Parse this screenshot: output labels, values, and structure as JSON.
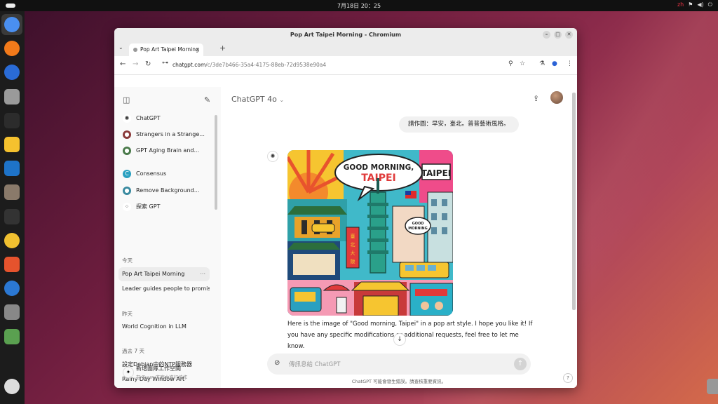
{
  "topbar": {
    "clock": "7月18日 20：25",
    "tray": [
      "zh",
      "⚑",
      "◀)",
      "⏻"
    ]
  },
  "dock": {
    "apps": [
      {
        "name": "chromium",
        "color": "#4a8ff0"
      },
      {
        "name": "firefox",
        "color": "#f27a1a"
      },
      {
        "name": "thunderbird",
        "color": "#2a6bd6"
      },
      {
        "name": "files",
        "color": "#9a9a9a"
      },
      {
        "name": "terminal",
        "color": "#2c2c2c"
      },
      {
        "name": "text-editor",
        "color": "#f5c12e"
      },
      {
        "name": "writer",
        "color": "#1e73c8"
      },
      {
        "name": "gimp",
        "color": "#8a7a6a"
      },
      {
        "name": "inkscape",
        "color": "#333333"
      },
      {
        "name": "rhythmbox",
        "color": "#f0c030"
      },
      {
        "name": "app-center",
        "color": "#e5532d"
      },
      {
        "name": "help",
        "color": "#2b78d3"
      },
      {
        "name": "disk",
        "color": "#888888"
      },
      {
        "name": "trash",
        "color": "#5aa050"
      },
      {
        "name": "ubuntu",
        "color": "#dddddd"
      }
    ]
  },
  "window": {
    "title": "Pop Art Taipei Morning - Chromium",
    "tab_title": "Pop Art Taipei Morning",
    "url_host": "chatgpt.com",
    "url_path": "/c/3de7b466-35a4-4175-88eb-72d9538e90a4"
  },
  "sidebar": {
    "pinned": [
      {
        "label": "ChatGPT",
        "icon": "openai-icon",
        "color": "#ffffff",
        "glyph": "✺"
      },
      {
        "label": "Strangers in a Strange...",
        "icon": "gpt-avatar-icon",
        "color": "#8a3a3a",
        "glyph": "●"
      },
      {
        "label": "GPT Aging Brain and...",
        "icon": "gpt-avatar-icon",
        "color": "#4a7a4a",
        "glyph": "●"
      },
      {
        "label": "Consensus",
        "icon": "consensus-icon",
        "color": "#2aa0c0",
        "glyph": "C"
      },
      {
        "label": "Remove Background...",
        "icon": "gpt-avatar-icon",
        "color": "#3a8aa0",
        "glyph": "●"
      },
      {
        "label": "探索 GPT",
        "icon": "grid-icon",
        "color": "#ffffff",
        "glyph": "⁘"
      }
    ],
    "sections": [
      {
        "title": "今天",
        "items": [
          "Pop Art Taipei Morning",
          "Leader guides people to promise"
        ]
      },
      {
        "title": "昨天",
        "items": [
          "World Cognition in LLM"
        ]
      },
      {
        "title": "過去 7 天",
        "items": [
          "設定Debian中的NTP服務器",
          "Rainy Day Window Art"
        ]
      }
    ],
    "team_title": "新增團隊工作空間",
    "team_sub": "在 Team 方案中進行協作"
  },
  "main": {
    "model": "ChatGPT 4o",
    "user_message": "請作圖：早安，臺北。普普藝術風格。",
    "image_text": {
      "bubble": "GOOD MORNING, TAIPEI",
      "sign": "TAIPEI",
      "small_bubble": "GOOD MORNING",
      "vertical_sign": "臺北大飯店"
    },
    "reply": "Here is the image of \"Good morning, Taipei\" in a pop art style. I hope you like it! If you have any specific modifications or additional requests, feel free to let me know.",
    "composer_placeholder": "傳訊息給 ChatGPT",
    "disclaimer": "ChatGPT 可能會發生錯誤。請查核重要資訊。"
  }
}
